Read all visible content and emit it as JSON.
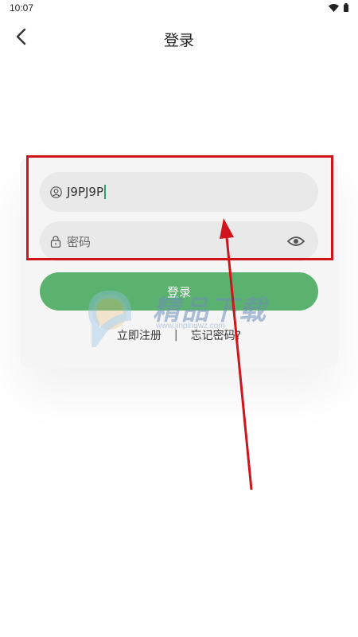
{
  "status_bar": {
    "time": "10:07",
    "icons": [
      "wifi-icon",
      "battery-icon"
    ]
  },
  "nav": {
    "title": "登录",
    "back_icon": "chevron-left-icon"
  },
  "form": {
    "username_value": "J9PJ9P",
    "username_icon": "user-icon",
    "password_placeholder": "密码",
    "password_icon": "lock-icon",
    "password_toggle_icon": "eye-icon"
  },
  "actions": {
    "login_label": "登录",
    "register_label": "立即注册",
    "divider": "|",
    "forgot_label": "忘记密码?"
  },
  "watermark": {
    "text": "精品下载",
    "url": "www.jinpinqwz.com"
  },
  "colors": {
    "login_button": "#5bb26f",
    "field_background": "#e9e9e9",
    "card_background": "#f5f5f5",
    "highlight": "#d0141b",
    "cursor": "#2aa36b"
  }
}
